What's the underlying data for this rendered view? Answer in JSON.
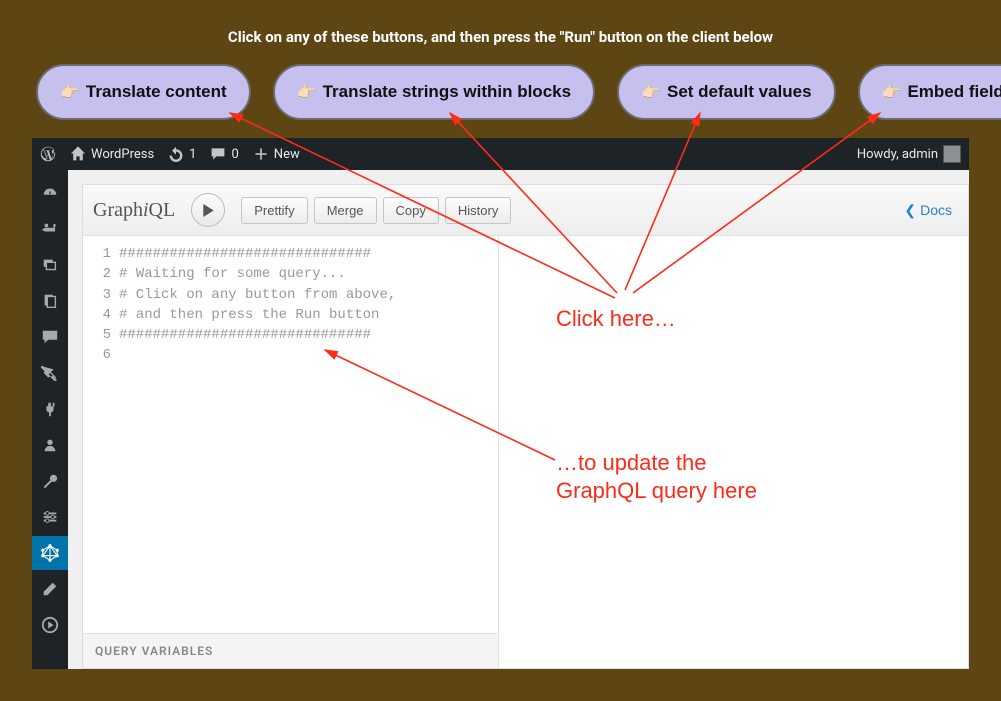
{
  "instruction": "Click on any of these buttons, and then press the \"Run\" button on the client below",
  "pills": {
    "translate_content": "Translate content",
    "translate_strings": "Translate strings within blocks",
    "set_defaults": "Set default values",
    "embed_fields": "Embed fields"
  },
  "adminbar": {
    "site_name": "WordPress",
    "refresh_count": "1",
    "comments_count": "0",
    "new_label": "New",
    "howdy": "Howdy, admin"
  },
  "graphiql": {
    "logo_pre": "Graph",
    "logo_i": "i",
    "logo_post": "QL",
    "prettify": "Prettify",
    "merge": "Merge",
    "copy": "Copy",
    "history": "History",
    "docs": "Docs",
    "query_variables": "QUERY VARIABLES",
    "lines": [
      "##############################",
      "# Waiting for some query...",
      "# Click on any button from above,",
      "# and then press the Run button",
      "##############################",
      ""
    ],
    "line_nums": [
      "1",
      "2",
      "3",
      "4",
      "5",
      "6"
    ]
  },
  "annotations": {
    "click_here": "Click here…",
    "update_here_1": "…to update the",
    "update_here_2": "GraphQL query here"
  }
}
